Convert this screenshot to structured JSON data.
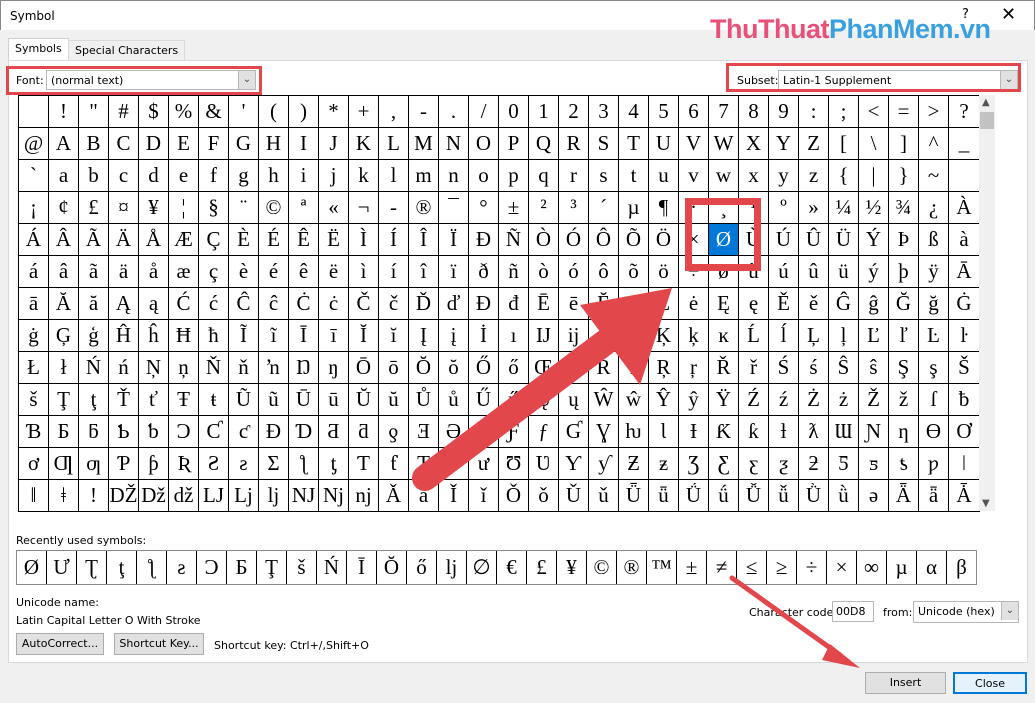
{
  "window": {
    "title": "Symbol",
    "help": "?",
    "close": "✕"
  },
  "watermark": {
    "part1": "ThuThuat",
    "part2": "PhanMem.vn"
  },
  "tabs": [
    {
      "label": "Symbols",
      "active": true
    },
    {
      "label": "Special Characters",
      "active": false
    }
  ],
  "font": {
    "label": "Font:",
    "value": "(normal text)"
  },
  "subset": {
    "label": "Subset:",
    "value": "Latin-1 Supplement"
  },
  "grid": {
    "selected": {
      "row": 4,
      "col": 23,
      "char": "Ø"
    },
    "rows": [
      " !\"#$%&'()*+,-./0123456789:;<=>?",
      "@ABCDEFGHIJKLMNOPQRSTUVWXYZ[\\]^_",
      "`abcdefghijklmnopqrstuvwxyz{|}~ ",
      "¡¢£¤¥¦§¨©ª«¬-®¯°±²³´µ¶·¸¹º»¼½¾¿À",
      "ÁÂÃÄÅÆÇÈÉÊËÌÍÎÏÐÑÒÓÔÕÖ×ØÙÚÛÜÝÞßà",
      "áâãäåæçèéêëìíîïðñòóôõö÷øùúûüýþÿĀ",
      "āĂăĄąĆćĈĉĊċČčĎďĐđĒēĔĕĖėĘęĚěĜĝĞğĠ",
      "ġĢģĤĥĦħĨĩĪīĬĭĮįİıĲĳĴĵĶķĸĹĺĻļĽľĿŀ",
      "ŁłŃńŅņŇňŉŊŋŌōŎŏŐőŒœŔŕŖŗŘřŚśŜŝŞşŠ",
      "šŢţŤťŦŧŨũŪūŬŭŮůŰűŲųŴŵŶŷŸŹźŻżŽžſƀ",
      "ƁƂƃƄƅƆƇƈƉƊƋƌƍƎƏƐƑƒƓƔƕƖƗƘƙƚƛƜƝƞƟƠ",
      "ơƢƣƤƥƦƧƨƩƪƫƬƭƮƯưƱƲƳƴƵƶƷƸƹƺƻƼƽƾƿǀ",
      "ǁǂǃǄǅǆǇǈǉǊǋǌǍǎǏǐǑǒǓǔǕǖǗǘǙǚǛǜǝǞǟǠ"
    ]
  },
  "recent": {
    "label": "Recently used symbols:",
    "symbols": [
      "Ø",
      "Ư",
      "Ʈ",
      "ţ",
      "ƪ",
      "ƨ",
      "Ɔ",
      "Б",
      "Ţ",
      "š",
      "Ń",
      "Ī",
      "Ŏ",
      "ő",
      "ǉ",
      "∅",
      "€",
      "£",
      "¥",
      "©",
      "®",
      "™",
      "±",
      "≠",
      "≤",
      "≥",
      "÷",
      "×",
      "∞",
      "µ",
      "α",
      "β"
    ]
  },
  "unicode_name": {
    "label": "Unicode name:",
    "value": "Latin Capital Letter O With Stroke"
  },
  "char_code": {
    "label": "Character code:",
    "value": "00D8",
    "from_label": "from:",
    "from_value": "Unicode (hex)"
  },
  "buttons": {
    "autocorrect": "AutoCorrect...",
    "shortcut_key": "Shortcut Key...",
    "shortcut_text": "Shortcut key: Ctrl+/,Shift+O",
    "insert": "Insert",
    "close": "Close"
  },
  "colors": {
    "selection": "#0078d7",
    "annotation": "#e2474c"
  }
}
